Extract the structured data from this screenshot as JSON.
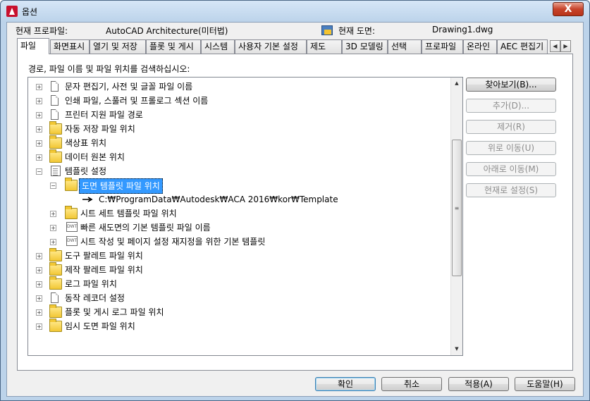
{
  "window": {
    "title": "옵션",
    "close_label": "X"
  },
  "info": {
    "profile_label": "현재 프로파일:",
    "profile_value": "AutoCAD Architecture(미터법)",
    "drawing_label": "현재 도면:",
    "drawing_value": "Drawing1.dwg"
  },
  "tabs": [
    {
      "label": "파일"
    },
    {
      "label": "화면표시"
    },
    {
      "label": "열기 및 저장"
    },
    {
      "label": "플롯 및 게시"
    },
    {
      "label": "시스템"
    },
    {
      "label": "사용자 기본 설정"
    },
    {
      "label": "제도"
    },
    {
      "label": "3D 모델링"
    },
    {
      "label": "선택"
    },
    {
      "label": "프로파일"
    },
    {
      "label": "온라인"
    },
    {
      "label": "AEC 편집기"
    }
  ],
  "tab_scroll": {
    "left": "◀",
    "right": "▶"
  },
  "panel": {
    "prompt": "경로, 파일 이름 및 파일 위치를 검색하십시오:"
  },
  "tree": {
    "items": [
      {
        "label": "문자 편집기, 사전 및 글꼴 파일 이름",
        "icon": "document-icon",
        "expander": "+"
      },
      {
        "label": "인쇄 파일, 스풀러 및 프롤로그 섹션 이름",
        "icon": "document-icon",
        "expander": "+"
      },
      {
        "label": "프린터 지원 파일 경로",
        "icon": "document-icon",
        "expander": "+"
      },
      {
        "label": "자동 저장 파일 위치",
        "icon": "folder-icon",
        "expander": "+"
      },
      {
        "label": "색상표 위치",
        "icon": "folder-icon",
        "expander": "+"
      },
      {
        "label": "데이터 원본 위치",
        "icon": "folder-icon",
        "expander": "+"
      },
      {
        "label": "템플릿 설정",
        "icon": "documents-icon",
        "expander": "−"
      },
      {
        "label": "도면 템플릿 파일 위치",
        "icon": "folder-icon",
        "expander": "−"
      },
      {
        "label": "C:₩ProgramData₩Autodesk₩ACA 2016₩kor₩Template",
        "icon": "arrow-icon",
        "expander": ""
      },
      {
        "label": "시트 세트 템플릿 파일 위치",
        "icon": "folder-icon",
        "expander": "+"
      },
      {
        "label": "빠른 새도면의 기본 템플릿 파일 이름",
        "icon": "dwg-file-icon",
        "expander": "+"
      },
      {
        "label": "시트 작성 및 페이지 설정 재지정을 위한 기본 템플릿",
        "icon": "dwg-file-icon",
        "expander": "+"
      },
      {
        "label": "도구 팔레트 파일 위치",
        "icon": "folder-icon",
        "expander": "+"
      },
      {
        "label": "제작 팔레트 파일 위치",
        "icon": "folder-icon",
        "expander": "+"
      },
      {
        "label": "로그 파일 위치",
        "icon": "folder-icon",
        "expander": "+"
      },
      {
        "label": "동작 레코더 설정",
        "icon": "document-icon",
        "expander": "+"
      },
      {
        "label": "플롯 및 게시 로그 파일 위치",
        "icon": "folder-icon",
        "expander": "+"
      },
      {
        "label": "임시 도면 파일 위치",
        "icon": "folder-icon",
        "expander": "+"
      }
    ],
    "scroll_up": "▲",
    "scroll_down": "▼",
    "scroll_grip": "≡"
  },
  "side_buttons": {
    "browse": "찾아보기(B)...",
    "add": "추가(D)...",
    "remove": "제거(R)",
    "move_up": "위로 이동(U)",
    "move_down": "아래로 이동(M)",
    "set_current": "현재로 설정(S)"
  },
  "bottom_buttons": {
    "ok": "확인",
    "cancel": "취소",
    "apply": "적용(A)",
    "help": "도움말(H)"
  }
}
